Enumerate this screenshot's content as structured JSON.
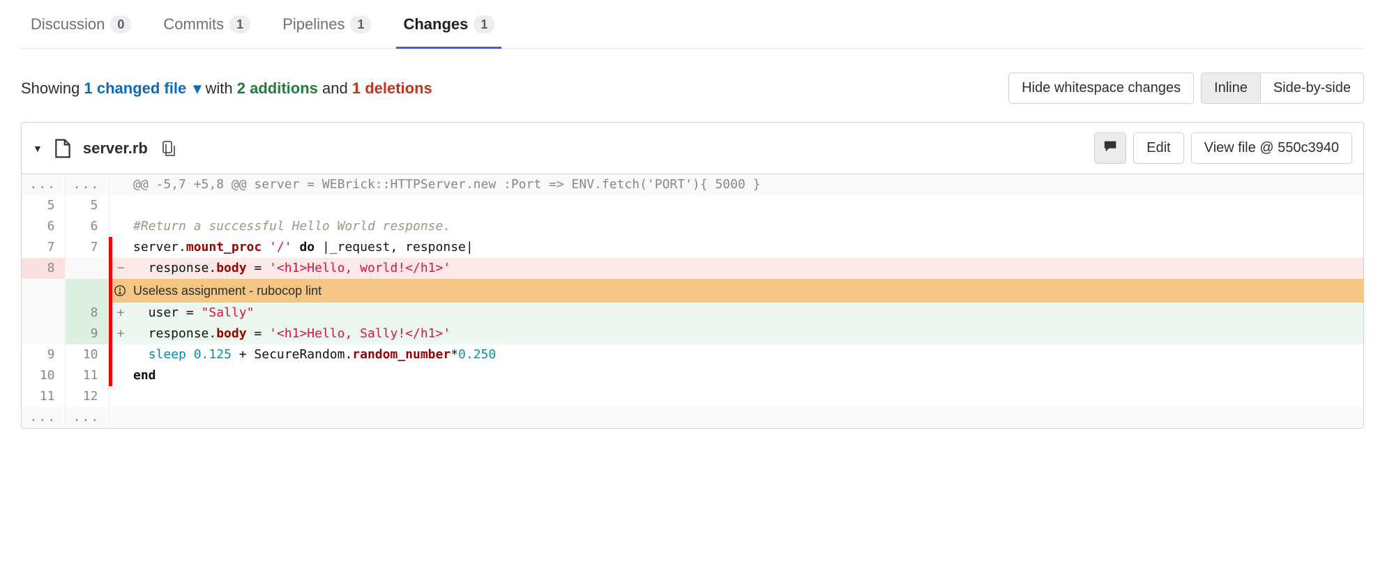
{
  "tabs": [
    {
      "label": "Discussion",
      "count": "0",
      "active": false
    },
    {
      "label": "Commits",
      "count": "1",
      "active": false
    },
    {
      "label": "Pipelines",
      "count": "1",
      "active": false
    },
    {
      "label": "Changes",
      "count": "1",
      "active": true
    }
  ],
  "summary": {
    "prefix": "Showing ",
    "changed_files": "1 changed file",
    "with": " with ",
    "additions": "2 additions",
    "and": " and ",
    "deletions": "1 deletions"
  },
  "controls": {
    "hide_whitespace": "Hide whitespace changes",
    "inline": "Inline",
    "side_by_side": "Side-by-side"
  },
  "file": {
    "name": "server.rb",
    "edit_label": "Edit",
    "view_file_label": "View file @ 550c3940",
    "hunk_header": "@@ -5,7 +5,8 @@ server = WEBrick::HTTPServer.new :Port => ENV.fetch('PORT'){ 5000 }",
    "lint_message": "Useless assignment - rubocop lint",
    "diff": {
      "ellipsis_old": "...",
      "ellipsis_new": "...",
      "lines": [
        {
          "type": "ctx",
          "old": "5",
          "new": "5",
          "mark": "none",
          "sign": "",
          "tokens": []
        },
        {
          "type": "ctx",
          "old": "6",
          "new": "6",
          "mark": "none",
          "sign": "",
          "tokens": [
            [
              "c",
              "#Return a successful Hello World response."
            ]
          ]
        },
        {
          "type": "ctx",
          "old": "7",
          "new": "7",
          "mark": "red",
          "sign": "",
          "tokens": [
            [
              "pl",
              "server."
            ],
            [
              "nf",
              "mount_proc"
            ],
            [
              "pl",
              " "
            ],
            [
              "s",
              "'/'"
            ],
            [
              "pl",
              " "
            ],
            [
              "k",
              "do"
            ],
            [
              "pl",
              " |_request, response|"
            ]
          ]
        },
        {
          "type": "removed",
          "old": "8",
          "new": "",
          "mark": "red",
          "sign": "−",
          "tokens": [
            [
              "pl",
              "  response."
            ],
            [
              "nf",
              "body"
            ],
            [
              "pl",
              " = "
            ],
            [
              "s",
              "'<h1>Hello, world!</h1>'"
            ]
          ]
        },
        {
          "type": "warn",
          "old": "",
          "new": "",
          "mark": "red",
          "sign": "",
          "tokens": []
        },
        {
          "type": "added",
          "old": "",
          "new": "8",
          "mark": "red",
          "sign": "+",
          "tokens": [
            [
              "pl",
              "  user = "
            ],
            [
              "s",
              "\"Sally\""
            ]
          ]
        },
        {
          "type": "added",
          "old": "",
          "new": "9",
          "mark": "red",
          "sign": "+",
          "tokens": [
            [
              "pl",
              "  response."
            ],
            [
              "nf",
              "body"
            ],
            [
              "pl",
              " = "
            ],
            [
              "s",
              "'<h1>Hello, Sally!</h1>'"
            ]
          ]
        },
        {
          "type": "ctx",
          "old": "9",
          "new": "10",
          "mark": "red",
          "sign": "",
          "tokens": [
            [
              "pl",
              "  "
            ],
            [
              "nb",
              "sleep"
            ],
            [
              "pl",
              " "
            ],
            [
              "mi",
              "0.125"
            ],
            [
              "pl",
              " + SecureRandom."
            ],
            [
              "nf",
              "random_number"
            ],
            [
              "op",
              "*"
            ],
            [
              "mi",
              "0.250"
            ]
          ]
        },
        {
          "type": "ctx",
          "old": "10",
          "new": "11",
          "mark": "red",
          "sign": "",
          "tokens": [
            [
              "k",
              "end"
            ]
          ]
        },
        {
          "type": "ctx",
          "old": "11",
          "new": "12",
          "mark": "none",
          "sign": "",
          "tokens": []
        }
      ]
    }
  }
}
